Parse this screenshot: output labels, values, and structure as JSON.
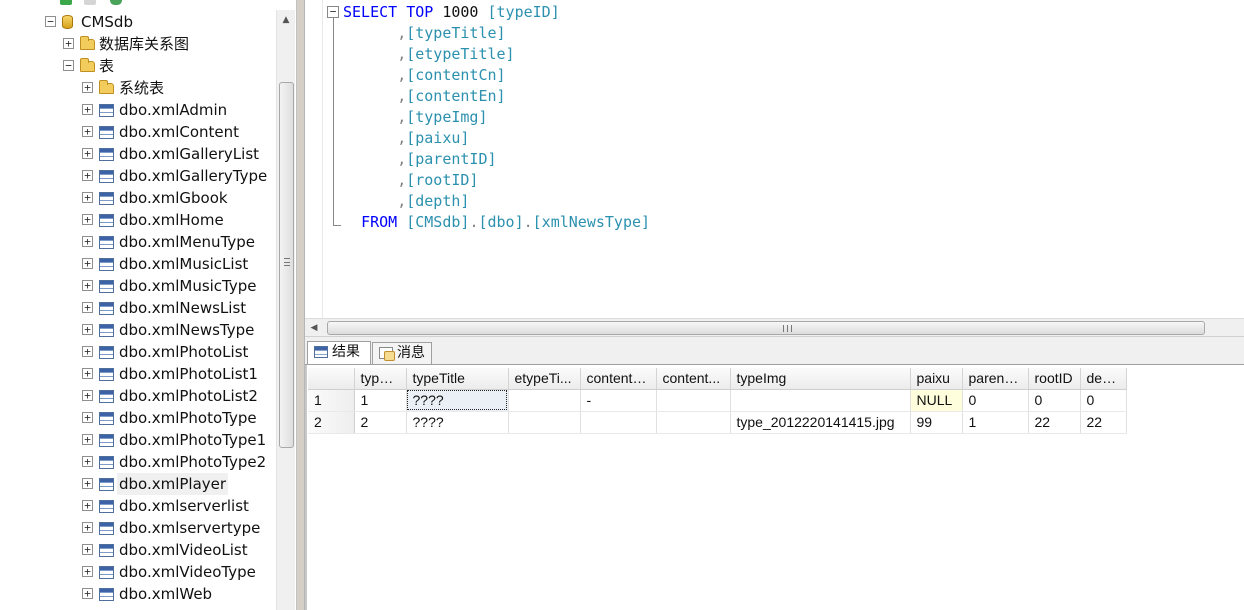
{
  "explorer": {
    "database": "CMSdb",
    "folders": {
      "diagrams": "数据库关系图",
      "tables": "表",
      "system_tables": "系统表"
    },
    "tables": [
      "dbo.xmlAdmin",
      "dbo.xmlContent",
      "dbo.xmlGalleryList",
      "dbo.xmlGalleryType",
      "dbo.xmlGbook",
      "dbo.xmlHome",
      "dbo.xmlMenuType",
      "dbo.xmlMusicList",
      "dbo.xmlMusicType",
      "dbo.xmlNewsList",
      "dbo.xmlNewsType",
      "dbo.xmlPhotoList",
      "dbo.xmlPhotoList1",
      "dbo.xmlPhotoList2",
      "dbo.xmlPhotoType",
      "dbo.xmlPhotoType1",
      "dbo.xmlPhotoType2",
      "dbo.xmlPlayer",
      "dbo.xmlserverlist",
      "dbo.xmlservertype",
      "dbo.xmlVideoList",
      "dbo.xmlVideoType",
      "dbo.xmlWeb"
    ],
    "selected_table": "dbo.xmlPlayer",
    "expand_symbol": "+",
    "collapse_symbol": "−"
  },
  "editor": {
    "select_kw": "SELECT",
    "top_kw": "TOP",
    "top_value": "1000",
    "first_column": "[typeID]",
    "columns": [
      "[typeTitle]",
      "[etypeTitle]",
      "[contentCn]",
      "[contentEn]",
      "[typeImg]",
      "[paixu]",
      "[parentID]",
      "[rootID]",
      "[depth]"
    ],
    "from_kw": "FROM",
    "from_db": "[CMSdb]",
    "from_schema": "[dbo]",
    "from_table": "[xmlNewsType]",
    "fold_symbol": "−"
  },
  "tabs": {
    "results": "结果",
    "messages": "消息"
  },
  "results": {
    "columns": [
      "typeID",
      "typeTitle",
      "etypeTi...",
      "contentCn",
      "content...",
      "typeImg",
      "paixu",
      "parentID",
      "rootID",
      "depth"
    ],
    "rows": [
      {
        "row": "1",
        "cells": [
          "1",
          "????",
          "",
          "-",
          "",
          "",
          "NULL",
          "0",
          "0",
          "0"
        ]
      },
      {
        "row": "2",
        "cells": [
          "2",
          "????",
          "",
          "",
          "",
          "type_2012220141415.jpg",
          "99",
          "1",
          "22",
          "22"
        ]
      }
    ]
  },
  "colors": {
    "keyword": "#0000ff",
    "identifier": "#2b91af",
    "operator": "#808080",
    "null_cell": "#fefedc"
  }
}
